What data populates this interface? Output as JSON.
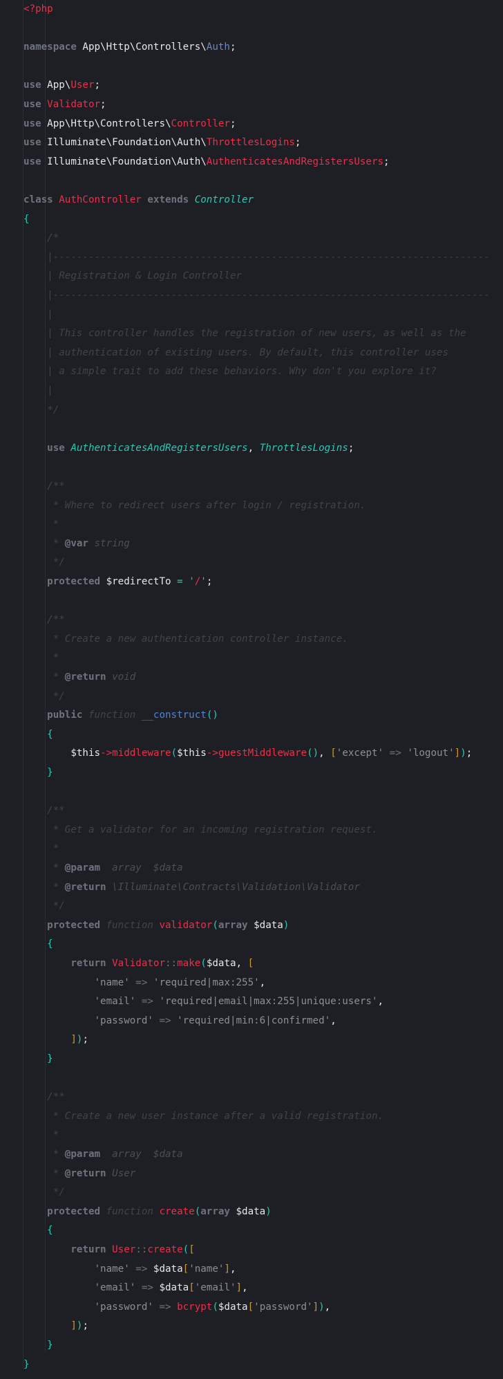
{
  "editor": {
    "background": "#1d1f24",
    "language": "php",
    "lines": [
      [
        [
          "<?php",
          "tag"
        ]
      ],
      [],
      [
        [
          "namespace ",
          "kw"
        ],
        [
          "App\\Http\\Controllers\\",
          "txt"
        ],
        [
          "Auth",
          "ns"
        ],
        [
          ";",
          "txt"
        ]
      ],
      [],
      [
        [
          "use ",
          "kw"
        ],
        [
          "App\\",
          "txt"
        ],
        [
          "User",
          "cls"
        ],
        [
          ";",
          "txt"
        ]
      ],
      [
        [
          "use ",
          "kw"
        ],
        [
          "Validator",
          "cls"
        ],
        [
          ";",
          "txt"
        ]
      ],
      [
        [
          "use ",
          "kw"
        ],
        [
          "App\\Http\\Controllers\\",
          "txt"
        ],
        [
          "Controller",
          "cls"
        ],
        [
          ";",
          "txt"
        ]
      ],
      [
        [
          "use ",
          "kw"
        ],
        [
          "Illuminate\\Foundation\\Auth\\",
          "txt"
        ],
        [
          "ThrottlesLogins",
          "cls"
        ],
        [
          ";",
          "txt"
        ]
      ],
      [
        [
          "use ",
          "kw"
        ],
        [
          "Illuminate\\Foundation\\Auth\\",
          "txt"
        ],
        [
          "AuthenticatesAndRegistersUsers",
          "cls"
        ],
        [
          ";",
          "txt"
        ]
      ],
      [],
      [
        [
          "class ",
          "kw"
        ],
        [
          "AuthController",
          "cls"
        ],
        [
          " extends ",
          "kw"
        ],
        [
          "Controller",
          "inh"
        ]
      ],
      [
        [
          "{",
          "br"
        ]
      ],
      [
        [
          "    "
        ],
        [
          "/*",
          "cmt"
        ]
      ],
      [
        [
          "    "
        ],
        [
          "|--------------------------------------------------------------------------",
          "cmt"
        ]
      ],
      [
        [
          "    "
        ],
        [
          "| Registration & Login Controller",
          "cmt"
        ]
      ],
      [
        [
          "    "
        ],
        [
          "|--------------------------------------------------------------------------",
          "cmt"
        ]
      ],
      [
        [
          "    "
        ],
        [
          "|",
          "cmt"
        ]
      ],
      [
        [
          "    "
        ],
        [
          "| This controller handles the registration of new users, as well as the",
          "cmt"
        ]
      ],
      [
        [
          "    "
        ],
        [
          "| authentication of existing users. By default, this controller uses",
          "cmt"
        ]
      ],
      [
        [
          "    "
        ],
        [
          "| a simple trait to add these behaviors. Why don't you explore it?",
          "cmt"
        ]
      ],
      [
        [
          "    "
        ],
        [
          "|",
          "cmt"
        ]
      ],
      [
        [
          "    "
        ],
        [
          "*/",
          "cmt"
        ]
      ],
      [],
      [
        [
          "    "
        ],
        [
          "use ",
          "kw"
        ],
        [
          "AuthenticatesAndRegistersUsers",
          "inh"
        ],
        [
          ", ",
          "txt"
        ],
        [
          "ThrottlesLogins",
          "inh"
        ],
        [
          ";",
          "txt"
        ]
      ],
      [],
      [
        [
          "    "
        ],
        [
          "/**",
          "cmt"
        ]
      ],
      [
        [
          "    "
        ],
        [
          " * Where to redirect users after login / registration.",
          "cmt"
        ]
      ],
      [
        [
          "    "
        ],
        [
          " *",
          "cmt"
        ]
      ],
      [
        [
          "    "
        ],
        [
          " * ",
          "cmt"
        ],
        [
          "@var",
          "doc"
        ],
        [
          " string",
          "dty"
        ]
      ],
      [
        [
          "    "
        ],
        [
          " */",
          "cmt"
        ]
      ],
      [
        [
          "    "
        ],
        [
          "protected ",
          "kw"
        ],
        [
          "$redirectTo ",
          "var"
        ],
        [
          "=",
          "eq"
        ],
        [
          " ",
          "txt"
        ],
        [
          "'",
          "str"
        ],
        [
          "/",
          "cls"
        ],
        [
          "'",
          "str"
        ],
        [
          ";",
          "txt"
        ]
      ],
      [],
      [
        [
          "    "
        ],
        [
          "/**",
          "cmt"
        ]
      ],
      [
        [
          "    "
        ],
        [
          " * Create a new authentication controller instance.",
          "cmt"
        ]
      ],
      [
        [
          "    "
        ],
        [
          " *",
          "cmt"
        ]
      ],
      [
        [
          "    "
        ],
        [
          " * ",
          "cmt"
        ],
        [
          "@return",
          "doc"
        ],
        [
          " void",
          "dty"
        ]
      ],
      [
        [
          "    "
        ],
        [
          " */",
          "cmt"
        ]
      ],
      [
        [
          "    "
        ],
        [
          "public ",
          "kw"
        ],
        [
          "function ",
          "fi"
        ],
        [
          "__construct",
          "fn"
        ],
        [
          "()",
          "br"
        ]
      ],
      [
        [
          "    "
        ],
        [
          "{",
          "br"
        ]
      ],
      [
        [
          "        "
        ],
        [
          "$this",
          "var"
        ],
        [
          "->",
          "cls"
        ],
        [
          "middleware",
          "cls"
        ],
        [
          "(",
          "br"
        ],
        [
          "$this",
          "var"
        ],
        [
          "->",
          "cls"
        ],
        [
          "guestMiddleware",
          "cls"
        ],
        [
          "()",
          "br"
        ],
        [
          ", ",
          "txt"
        ],
        [
          "[",
          "sb"
        ],
        [
          "'except'",
          "str"
        ],
        [
          " => ",
          "op"
        ],
        [
          "'logout'",
          "str"
        ],
        [
          "]",
          "sb"
        ],
        [
          ")",
          "br"
        ],
        [
          ";",
          "txt"
        ]
      ],
      [
        [
          "    "
        ],
        [
          "}",
          "br"
        ]
      ],
      [],
      [
        [
          "    "
        ],
        [
          "/**",
          "cmt"
        ]
      ],
      [
        [
          "    "
        ],
        [
          " * Get a validator for an incoming registration request.",
          "cmt"
        ]
      ],
      [
        [
          "    "
        ],
        [
          " *",
          "cmt"
        ]
      ],
      [
        [
          "    "
        ],
        [
          " * ",
          "cmt"
        ],
        [
          "@param",
          "doc"
        ],
        [
          "  array  $data",
          "dty"
        ]
      ],
      [
        [
          "    "
        ],
        [
          " * ",
          "cmt"
        ],
        [
          "@return",
          "doc"
        ],
        [
          " \\Illuminate\\Contracts\\Validation\\Validator",
          "dty"
        ]
      ],
      [
        [
          "    "
        ],
        [
          " */",
          "cmt"
        ]
      ],
      [
        [
          "    "
        ],
        [
          "protected ",
          "kw"
        ],
        [
          "function ",
          "fi"
        ],
        [
          "validator",
          "cls"
        ],
        [
          "(",
          "br"
        ],
        [
          "array ",
          "kw"
        ],
        [
          "$data",
          "var"
        ],
        [
          ")",
          "br"
        ]
      ],
      [
        [
          "    "
        ],
        [
          "{",
          "br"
        ]
      ],
      [
        [
          "        "
        ],
        [
          "return ",
          "kw"
        ],
        [
          "Validator",
          "cls"
        ],
        [
          "::",
          "op"
        ],
        [
          "make",
          "cls"
        ],
        [
          "(",
          "br"
        ],
        [
          "$data",
          "var"
        ],
        [
          ", ",
          "txt"
        ],
        [
          "[",
          "sb"
        ]
      ],
      [
        [
          "            "
        ],
        [
          "'name'",
          "str"
        ],
        [
          " => ",
          "op"
        ],
        [
          "'required|max:255'",
          "str"
        ],
        [
          ",",
          "txt"
        ]
      ],
      [
        [
          "            "
        ],
        [
          "'email'",
          "str"
        ],
        [
          " => ",
          "op"
        ],
        [
          "'required|email|max:255|unique:users'",
          "str"
        ],
        [
          ",",
          "txt"
        ]
      ],
      [
        [
          "            "
        ],
        [
          "'password'",
          "str"
        ],
        [
          " => ",
          "op"
        ],
        [
          "'required|min:6|confirmed'",
          "str"
        ],
        [
          ",",
          "txt"
        ]
      ],
      [
        [
          "        "
        ],
        [
          "]",
          "sb"
        ],
        [
          ")",
          "br"
        ],
        [
          ";",
          "txt"
        ]
      ],
      [
        [
          "    "
        ],
        [
          "}",
          "br"
        ]
      ],
      [],
      [
        [
          "    "
        ],
        [
          "/**",
          "cmt"
        ]
      ],
      [
        [
          "    "
        ],
        [
          " * Create a new user instance after a valid registration.",
          "cmt"
        ]
      ],
      [
        [
          "    "
        ],
        [
          " *",
          "cmt"
        ]
      ],
      [
        [
          "    "
        ],
        [
          " * ",
          "cmt"
        ],
        [
          "@param",
          "doc"
        ],
        [
          "  array  $data",
          "dty"
        ]
      ],
      [
        [
          "    "
        ],
        [
          " * ",
          "cmt"
        ],
        [
          "@return",
          "doc"
        ],
        [
          " User",
          "dty"
        ]
      ],
      [
        [
          "    "
        ],
        [
          " */",
          "cmt"
        ]
      ],
      [
        [
          "    "
        ],
        [
          "protected ",
          "kw"
        ],
        [
          "function ",
          "fi"
        ],
        [
          "create",
          "cls"
        ],
        [
          "(",
          "br"
        ],
        [
          "array ",
          "kw"
        ],
        [
          "$data",
          "var"
        ],
        [
          ")",
          "br"
        ]
      ],
      [
        [
          "    "
        ],
        [
          "{",
          "br"
        ]
      ],
      [
        [
          "        "
        ],
        [
          "return ",
          "kw"
        ],
        [
          "User",
          "cls"
        ],
        [
          "::",
          "op"
        ],
        [
          "create",
          "cls"
        ],
        [
          "(",
          "br"
        ],
        [
          "[",
          "sb"
        ]
      ],
      [
        [
          "            "
        ],
        [
          "'name'",
          "str"
        ],
        [
          " => ",
          "op"
        ],
        [
          "$data",
          "var"
        ],
        [
          "[",
          "sb"
        ],
        [
          "'name'",
          "str"
        ],
        [
          "]",
          "sb"
        ],
        [
          ",",
          "txt"
        ]
      ],
      [
        [
          "            "
        ],
        [
          "'email'",
          "str"
        ],
        [
          " => ",
          "op"
        ],
        [
          "$data",
          "var"
        ],
        [
          "[",
          "sb"
        ],
        [
          "'email'",
          "str"
        ],
        [
          "]",
          "sb"
        ],
        [
          ",",
          "txt"
        ]
      ],
      [
        [
          "            "
        ],
        [
          "'password'",
          "str"
        ],
        [
          " => ",
          "op"
        ],
        [
          "bcrypt",
          "cls"
        ],
        [
          "(",
          "br"
        ],
        [
          "$data",
          "var"
        ],
        [
          "[",
          "sb"
        ],
        [
          "'password'",
          "str"
        ],
        [
          "]",
          "sb"
        ],
        [
          ")",
          "br"
        ],
        [
          ",",
          "txt"
        ]
      ],
      [
        [
          "        "
        ],
        [
          "]",
          "sb"
        ],
        [
          ")",
          "br"
        ],
        [
          ";",
          "txt"
        ]
      ],
      [
        [
          "    "
        ],
        [
          "}",
          "br"
        ]
      ],
      [
        [
          "}",
          "br"
        ]
      ]
    ]
  }
}
